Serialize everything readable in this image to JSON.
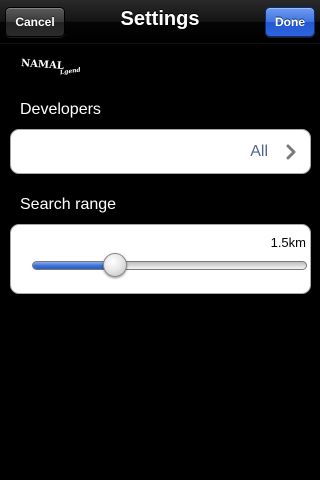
{
  "navbar": {
    "title": "Settings",
    "cancel_label": "Cancel",
    "done_label": "Done"
  },
  "logo": {
    "text": "NAMAL",
    "suffix": "Lgend"
  },
  "developers": {
    "label": "Developers",
    "value": "All",
    "icon": "chevron-right-icon"
  },
  "search_range": {
    "label": "Search range",
    "value_text": "1.5km",
    "slider_fraction": 0.3
  },
  "colors": {
    "accent": "#2e64db",
    "value_text": "#51668f",
    "background": "#000000"
  }
}
